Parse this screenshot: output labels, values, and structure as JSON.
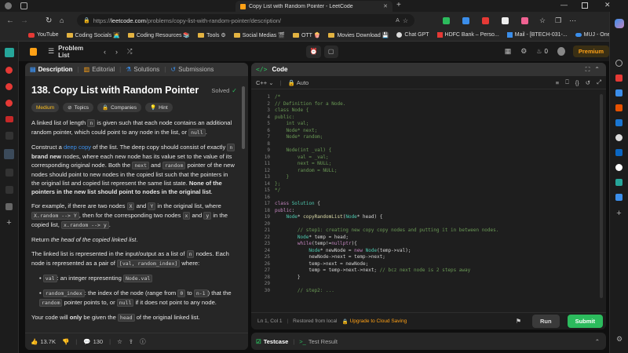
{
  "browser": {
    "tab_title": "Copy List with Random Pointer - LeetCode",
    "url_prefix": "https://",
    "url_host": "leetcode.com",
    "url_path": "/problems/copy-list-with-random-pointer/description/",
    "bookmarks": [
      "YouTube",
      "Coding Socials 🧑‍💻",
      "Coding Resources 📚",
      "Tools ⚙",
      "Social Medias 🎬",
      "OTT 🍿",
      "Movies Download 💾",
      "Chat GPT",
      "HDFC Bank – Perso...",
      "Mail - [BTECH-031-...",
      "MUJ - OneDrive"
    ]
  },
  "nav": {
    "problem_list": "Problem List",
    "streak_count": "0",
    "premium": "Premium"
  },
  "left_tabs": {
    "description": "Description",
    "editorial": "Editorial",
    "solutions": "Solutions",
    "submissions": "Submissions"
  },
  "problem": {
    "title": "138. Copy List with Random Pointer",
    "status": "Solved",
    "difficulty": "Medium",
    "tags": [
      "Topics",
      "Companies",
      "Hint"
    ],
    "p1_a": "A linked list of length ",
    "p1_n": "n",
    "p1_b": " is given such that each node contains an additional random pointer, which could point to any node in the list, or ",
    "p1_null": "null",
    "p1_c": ".",
    "p2_a": "Construct a ",
    "p2_link": "deep copy",
    "p2_b": " of the list. The deep copy should consist of exactly ",
    "p2_n": "n",
    "p2_bold": "brand new",
    "p2_c": " nodes, where each new node has its value set to the value of its corresponding original node. Both the ",
    "p2_next": "next",
    "p2_d": " and ",
    "p2_random": "random",
    "p2_e": " pointer of the new nodes should point to new nodes in the copied list such that the pointers in the original list and copied list represent the same list state. ",
    "p2_bold2": "None of the pointers in the new list should point to nodes in the original list",
    "p2_f": ".",
    "p3_a": "For example, if there are two nodes ",
    "p3_x": "X",
    "p3_and": " and ",
    "p3_y": "Y",
    "p3_b": " in the original list, where ",
    "p3_code1": "X.random --> Y",
    "p3_c": ", then for the corresponding two nodes ",
    "p3_x2": "x",
    "p3_and2": " and ",
    "p3_y2": "y",
    "p3_d": " in the copied list, ",
    "p3_code2": "x.random --> y",
    "p3_e": ".",
    "p4_a": "Return ",
    "p4_em": "the head of the copied linked list",
    "p4_b": ".",
    "p5_a": "The linked list is represented in the input/output as a list of ",
    "p5_n": "n",
    "p5_b": " nodes. Each node is represented as a pair of ",
    "p5_code": "[val, random_index]",
    "p5_c": " where:",
    "li1_code": "val",
    "li1_text": ": an integer representing ",
    "li1_code2": "Node.val",
    "li2_code": "random_index",
    "li2_a": ": the index of the node (range from ",
    "li2_0": "0",
    "li2_to": " to ",
    "li2_n1": "n-1",
    "li2_b": ") that the ",
    "li2_random": "random",
    "li2_c": " pointer points to, or ",
    "li2_null": "null",
    "li2_d": " if it does not point to any node.",
    "p6_a": "Your code will ",
    "p6_bold": "only",
    "p6_b": " be given the ",
    "p6_head": "head",
    "p6_c": " of the original linked list.",
    "likes": "13.7K",
    "comments": "130"
  },
  "code_panel": {
    "title": "Code",
    "language": "C++",
    "mode": "Auto",
    "status_pos": "Ln 1, Col 1",
    "status_saved": "Restored from local",
    "status_upgrade": "Upgrade to Cloud Saving",
    "run": "Run",
    "submit": "Submit",
    "lines": [
      "/*",
      "// Definition for a Node.",
      "class Node {",
      "public:",
      "    int val;",
      "    Node* next;",
      "    Node* random;",
      "",
      "    Node(int _val) {",
      "        val = _val;",
      "        next = NULL;",
      "        random = NULL;",
      "    }",
      "};",
      "*/",
      "",
      "class Solution {",
      "public:",
      "    Node* copyRandomList(Node* head) {",
      "",
      "        // step1: creating new copy copy nodes and putting it in between nodes.",
      "        Node* temp = head;",
      "        while(temp!=nullptr){",
      "            Node* newNode = new Node(temp->val);",
      "            newNode->next = temp->next;",
      "            temp->next = newNode;",
      "            temp = temp->next->next; // bcz next node is 2 steps away",
      "        }",
      "",
      "        // step2: ..."
    ],
    "line_numbers": [
      "1",
      "2",
      "3",
      "4",
      "5",
      "6",
      "7",
      "8",
      "9",
      "10",
      "11",
      "12",
      "13",
      "14",
      "15",
      "16",
      "17",
      "18",
      "19",
      "20",
      "21",
      "22",
      "23",
      "24",
      "25",
      "26",
      "27",
      "28",
      "29",
      "30"
    ]
  },
  "test_panel": {
    "testcase": "Testcase",
    "result": "Test Result"
  },
  "colors": {
    "accent_orange": "#ffa116",
    "submit_green": "#2cbb5d",
    "medium_yellow": "#ffc01e",
    "solved_green": "#2cbb5d",
    "link_blue": "#3b8eea"
  }
}
